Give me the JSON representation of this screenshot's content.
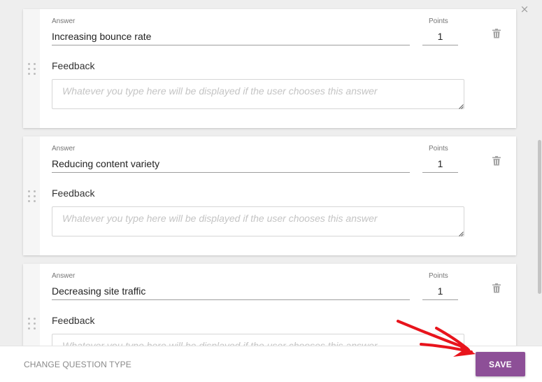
{
  "answers": [
    {
      "answer_label": "Answer",
      "answer_value": "Increasing bounce rate",
      "points_label": "Points",
      "points_value": "1",
      "feedback_label": "Feedback",
      "feedback_placeholder": "Whatever you type here will be displayed if the user chooses this answer"
    },
    {
      "answer_label": "Answer",
      "answer_value": "Reducing content variety",
      "points_label": "Points",
      "points_value": "1",
      "feedback_label": "Feedback",
      "feedback_placeholder": "Whatever you type here will be displayed if the user chooses this answer"
    },
    {
      "answer_label": "Answer",
      "answer_value": "Decreasing site traffic",
      "points_label": "Points",
      "points_value": "1",
      "feedback_label": "Feedback",
      "feedback_placeholder": "Whatever you type here will be displayed if the user chooses this answer"
    }
  ],
  "footer": {
    "change_type_label": "CHANGE QUESTION TYPE",
    "save_label": "SAVE"
  },
  "colors": {
    "accent": "#8d4f97",
    "annotation_arrow": "#e8141c"
  },
  "icons": {
    "close": "close-icon",
    "delete": "trash-icon",
    "drag": "drag-handle-icon"
  }
}
